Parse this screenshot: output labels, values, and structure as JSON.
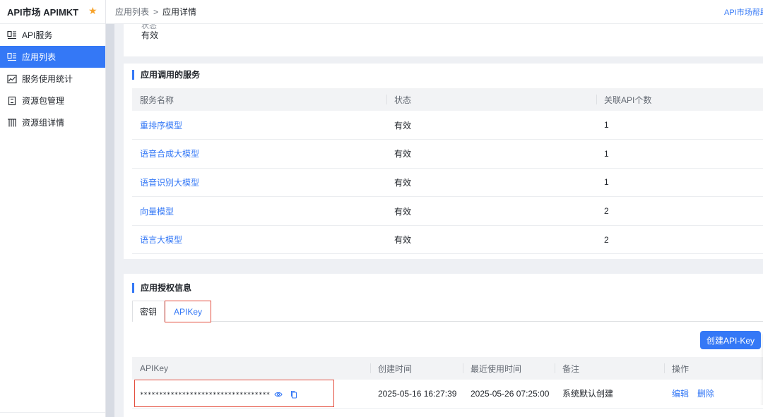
{
  "sidebar": {
    "brand": "API市场 APIMKT",
    "items": [
      {
        "label": "API服务",
        "icon": "api-service-icon",
        "active": false
      },
      {
        "label": "应用列表",
        "icon": "app-list-icon",
        "active": true
      },
      {
        "label": "服务使用统计",
        "icon": "chart-icon",
        "active": false
      },
      {
        "label": "资源包管理",
        "icon": "package-icon",
        "active": false
      },
      {
        "label": "资源组详情",
        "icon": "resource-group-icon",
        "active": false
      }
    ]
  },
  "header": {
    "breadcrumb_parent": "应用列表",
    "breadcrumb_sep": ">",
    "breadcrumb_current": "应用详情",
    "help_link": "API市场帮助"
  },
  "status_card": {
    "label": "状态",
    "value": "有效"
  },
  "services": {
    "title": "应用调用的服务",
    "columns": [
      "服务名称",
      "状态",
      "关联API个数"
    ],
    "rows": [
      {
        "name": "重排序模型",
        "status": "有效",
        "api_count": "1"
      },
      {
        "name": "语音合成大模型",
        "status": "有效",
        "api_count": "1"
      },
      {
        "name": "语音识别大模型",
        "status": "有效",
        "api_count": "1"
      },
      {
        "name": "向量模型",
        "status": "有效",
        "api_count": "2"
      },
      {
        "name": "语言大模型",
        "status": "有效",
        "api_count": "2"
      }
    ]
  },
  "auth": {
    "title": "应用授权信息",
    "tabs": [
      "密钥",
      "APIKey"
    ],
    "active_tab": "APIKey",
    "create_button": "创建API-Key",
    "columns": [
      "APIKey",
      "创建时间",
      "最近使用时间",
      "备注",
      "操作"
    ],
    "rows": [
      {
        "key": "**********************************",
        "created": "2025-05-16 16:27:39",
        "last_used": "2025-05-26 07:25:00",
        "remark": "系统默认创建",
        "edit": "编辑",
        "delete": "删除"
      }
    ]
  },
  "colors": {
    "accent": "#3478f6",
    "highlight": "#e34d3d",
    "star": "#f7a32b"
  }
}
